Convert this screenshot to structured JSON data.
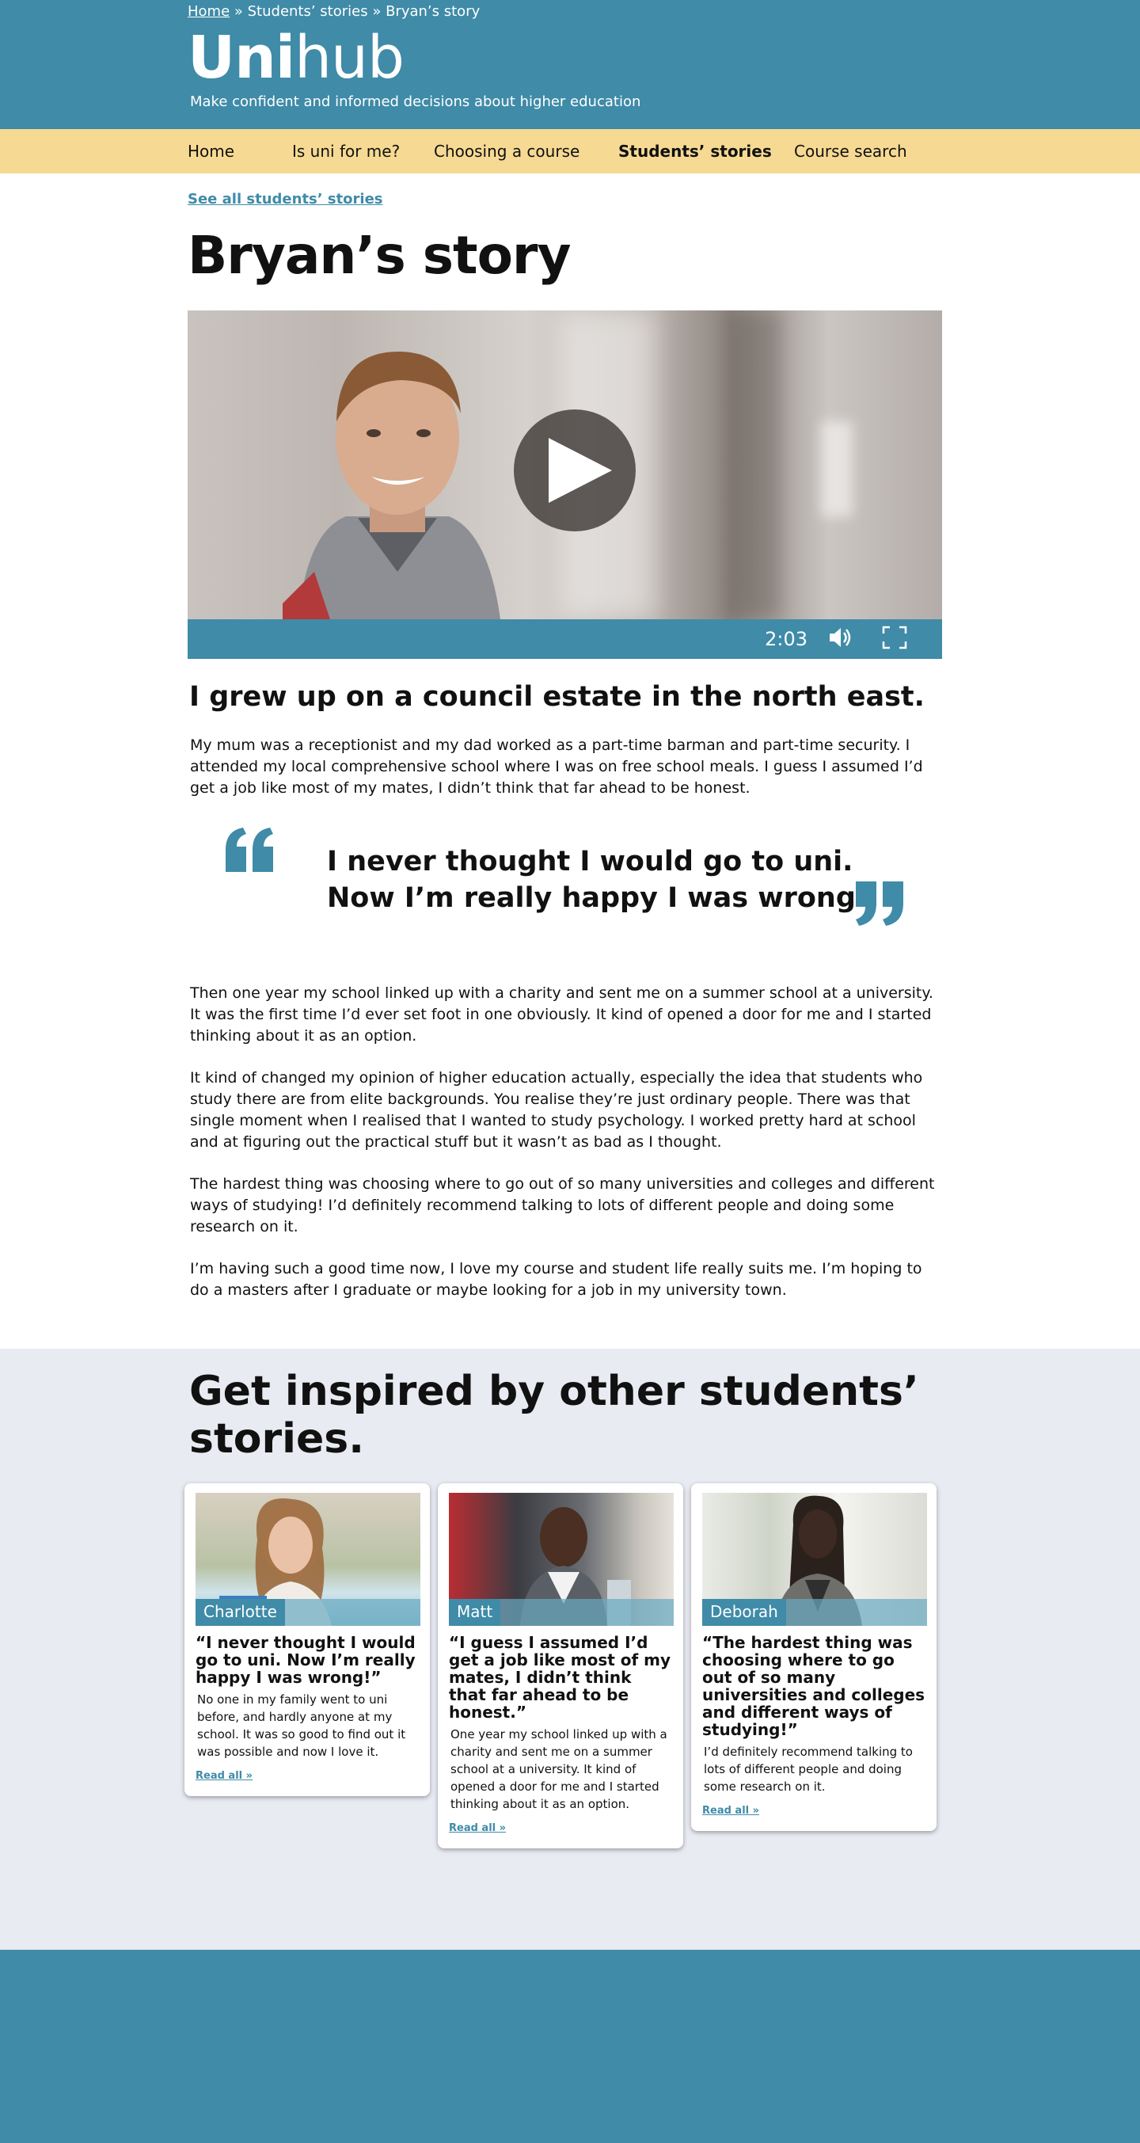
{
  "header": {
    "breadcrumb": {
      "home": "Home",
      "sep1": " » ",
      "stories": "Students’ stories",
      "sep2": " » ",
      "current": "Bryan’s story"
    },
    "logo": {
      "bold": "Uni",
      "light": "hub"
    },
    "tagline": "Make confident and informed decisions about higher education"
  },
  "nav": {
    "items": [
      {
        "label": "Home"
      },
      {
        "label": "Is uni for me?"
      },
      {
        "label": "Choosing a course"
      },
      {
        "label": "Students’ stories"
      },
      {
        "label": "Course search"
      }
    ],
    "active": "Students’ stories"
  },
  "main": {
    "see_all": "See all students’ stories",
    "title": "Bryan’s story",
    "video": {
      "duration": "2:03",
      "icons": [
        "play-icon",
        "volume-icon",
        "fullscreen-icon"
      ]
    },
    "lead": "I grew up on a council estate in the north east.",
    "para1": "My mum was a receptionist and my dad worked as a part-time barman and part-time security. I attended my local comprehensive school where I was on free school meals. I guess I assumed I’d get a job like most of my mates, I didn’t think that far ahead to be honest.",
    "quote": {
      "line1": "I never thought I would go to uni.",
      "line2": "Now I’m really happy I was wrong!"
    },
    "paragraphs": [
      "Then one year my school linked up with a charity and sent me on a summer school at a university. It was the first time I’d ever set foot in one obviously. It kind of opened a door for me and I started thinking about it as an option.",
      "It kind of changed my opinion of higher education actually, especially the idea that students who study there are from elite backgrounds. You realise they’re just ordinary people. There was that single moment when I realised that I wanted to study psychology. I worked pretty hard at school and at figuring out the practical stuff but it wasn’t as bad as I thought.",
      "The hardest thing was choosing where to go out of so many universities and colleges and different ways of studying! I’d definitely recommend talking to lots of different people and doing some research on it.",
      "I’m having such a good time now, I love my course and student life really suits me. I’m hoping to do a masters after I graduate or maybe looking for a job in my university town."
    ]
  },
  "stories": {
    "title": "Get inspired by other students’ stories.",
    "cards": [
      {
        "name": "Charlotte",
        "quote": "“I never thought I would go to uni. Now I’m really happy I was wrong!”",
        "body": "No one in my family went to uni before, and hardly anyone at my school. It was so good to find out it was possible and now I love it.",
        "link": "Read all »"
      },
      {
        "name": "Matt",
        "quote": "“I guess I assumed I’d get a job like most of my mates, I didn’t think that far ahead to be honest.”",
        "body": "One year my school linked up with a charity and sent me on a summer school at a university. It kind of opened a door for me and I started thinking about it as an option.",
        "link": "Read all »"
      },
      {
        "name": "Deborah",
        "quote": "“The hardest thing was choosing where to go out of so many universities and colleges and different ways of studying!”",
        "body": "I’d definitely recommend talking to lots of different people and doing some research on it.",
        "link": "Read all »"
      }
    ]
  },
  "colors": {
    "brand": "#3f8ba8",
    "nav_bg": "#f6d993",
    "stories_bg": "#e9ebf3"
  }
}
